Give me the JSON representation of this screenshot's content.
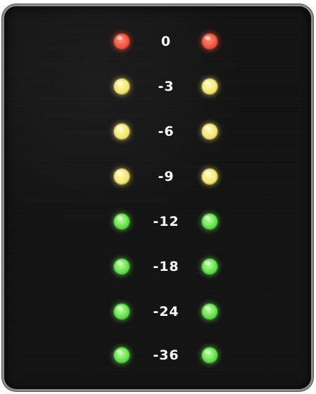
{
  "meter": {
    "levels": [
      {
        "label": "0",
        "color": "red",
        "hex": "#f0543e"
      },
      {
        "label": "-3",
        "color": "yellow",
        "hex": "#f2e670"
      },
      {
        "label": "-6",
        "color": "yellow",
        "hex": "#f2e670"
      },
      {
        "label": "-9",
        "color": "yellow",
        "hex": "#f2e670"
      },
      {
        "label": "-12",
        "color": "green",
        "hex": "#5fe04a"
      },
      {
        "label": "-18",
        "color": "green",
        "hex": "#5fe04a"
      },
      {
        "label": "-24",
        "color": "green",
        "hex": "#5fe04a"
      },
      {
        "label": "-36",
        "color": "green",
        "hex": "#5fe04a"
      }
    ]
  }
}
